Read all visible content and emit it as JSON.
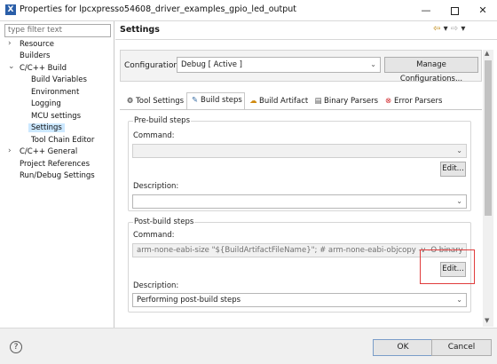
{
  "window": {
    "title": "Properties for lpcxpresso54608_driver_examples_gpio_led_output",
    "minimize": "—",
    "close": "✕"
  },
  "left_panel": {
    "filter_placeholder": "type filter text",
    "tree": [
      {
        "label": "Resource",
        "chevron": "›"
      },
      {
        "label": "Builders"
      },
      {
        "label": "C/C++ Build",
        "chevron": "⌄"
      },
      {
        "label": "Build Variables"
      },
      {
        "label": "Environment"
      },
      {
        "label": "Logging"
      },
      {
        "label": "MCU settings"
      },
      {
        "label": "Settings"
      },
      {
        "label": "Tool Chain Editor"
      },
      {
        "label": "C/C++ General",
        "chevron": "›"
      },
      {
        "label": "Project References"
      },
      {
        "label": "Run/Debug Settings"
      }
    ]
  },
  "header": {
    "title": "Settings",
    "nav_back": "⇦",
    "nav_drop": "▾",
    "nav_fwd": "⇨",
    "nav_menu": "▾"
  },
  "configuration": {
    "label": "Configuration:",
    "value": "Debug  [ Active ]",
    "manage_label": "Manage Configurations..."
  },
  "tabs": [
    {
      "label": "Tool Settings",
      "icon": "⚙"
    },
    {
      "label": "Build steps",
      "icon": "✎"
    },
    {
      "label": "Build Artifact",
      "icon": "☁"
    },
    {
      "label": "Binary Parsers",
      "icon": "▤"
    },
    {
      "label": "Error Parsers",
      "icon": "⊗"
    }
  ],
  "pre_build": {
    "title": "Pre-build steps",
    "command_label": "Command:",
    "command_value": "",
    "edit_label": "Edit...",
    "description_label": "Description:",
    "description_value": ""
  },
  "post_build": {
    "title": "Post-build steps",
    "command_label": "Command:",
    "command_value": "arm-none-eabi-size \"${BuildArtifactFileName}\"; # arm-none-eabi-objcopy -v -O binary \"${Bu",
    "edit_label": "Edit...",
    "description_label": "Description:",
    "description_value": "Performing post-build steps"
  },
  "footer": {
    "help": "?",
    "ok_label": "OK",
    "cancel_label": "Cancel"
  },
  "colors": {
    "selection": "#cce8ff",
    "highlight_box": "#e03c3c"
  }
}
